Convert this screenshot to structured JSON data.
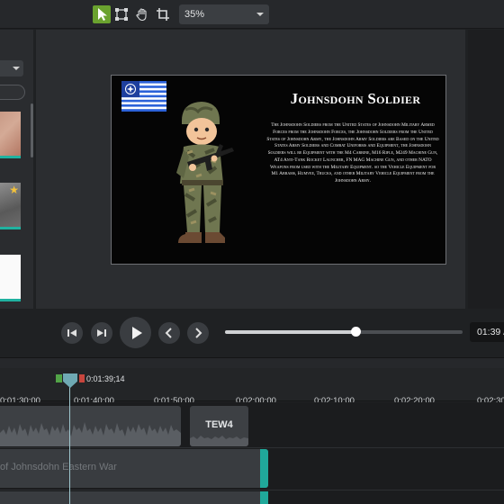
{
  "toolbar": {
    "tools": [
      "select-tool",
      "transform-tool",
      "hand-tool",
      "crop-tool"
    ],
    "zoom_value": "35%"
  },
  "canvas": {
    "slide_title": "Johnsdohn Soldier",
    "slide_body": "The Johnsdohn Soldiers from the United States of Johnsdohn Military Armed Forces from the Johnsdohn Forces, the Johnsdohn Soldiers from the United States of Johnsdohn Army, the Johnsdohn Army Soldiers are Based on the United States Army Soldiers and Combat Uniforms and Equipment, the Johnsdohn Soldiers will be Equipment with the M4 Carbine, M16 Rifle, M249 Machine Gun, AT4 Anti-Tank Rocket Launcher, FN MAG Machine Gun, and other NATO Weapons from used with the Military Equipment. so the Vehicle Equipment for M1 Abrams, Humvee, Trucks, and other Military Vehicle Equipment from the Johnsdohn Army."
  },
  "playback": {
    "time_display": "01:39 /",
    "progress": 0.55
  },
  "timeline": {
    "playhead_time": "0:01:39;14",
    "ticks": [
      "0:01:30;00",
      "0:01:40;00",
      "0:01:50;00",
      "0:02:00;00",
      "0:02:10;00",
      "0:02:20;00",
      "0:02:30"
    ],
    "clips": {
      "tew4_label": "TEW4",
      "video_label": "of Johnsdohn Eastern War"
    }
  },
  "colors": {
    "accent_green": "#6aa22f",
    "clip_teal": "#20a89a",
    "playhead": "#6fa9b3"
  }
}
